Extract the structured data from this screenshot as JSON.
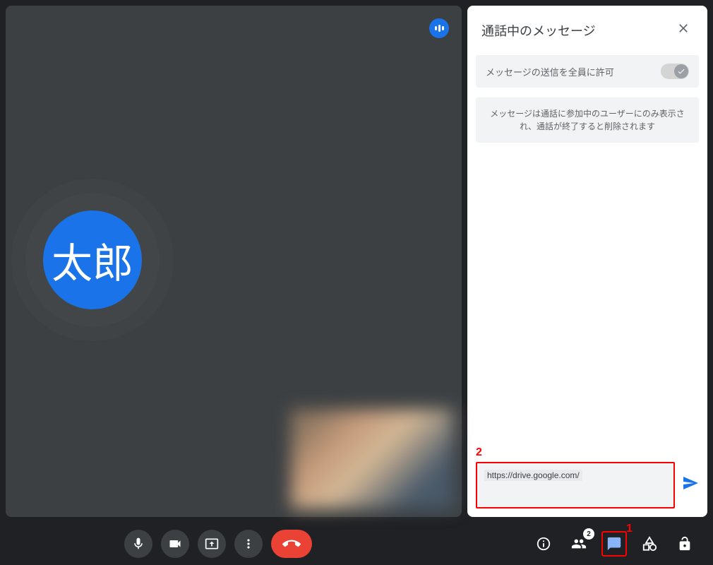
{
  "video": {
    "avatar_text": "太郎"
  },
  "chat": {
    "title": "通話中のメッセージ",
    "permission_label": "メッセージの送信を全員に許可",
    "info_text": "メッセージは通話に参加中のユーザーにのみ表示され、通話が終了すると削除されます",
    "input_value": "https://drive.google.com/"
  },
  "bottom": {
    "participants_count": "2"
  },
  "annotations": {
    "input": "2",
    "chat_button": "1"
  }
}
